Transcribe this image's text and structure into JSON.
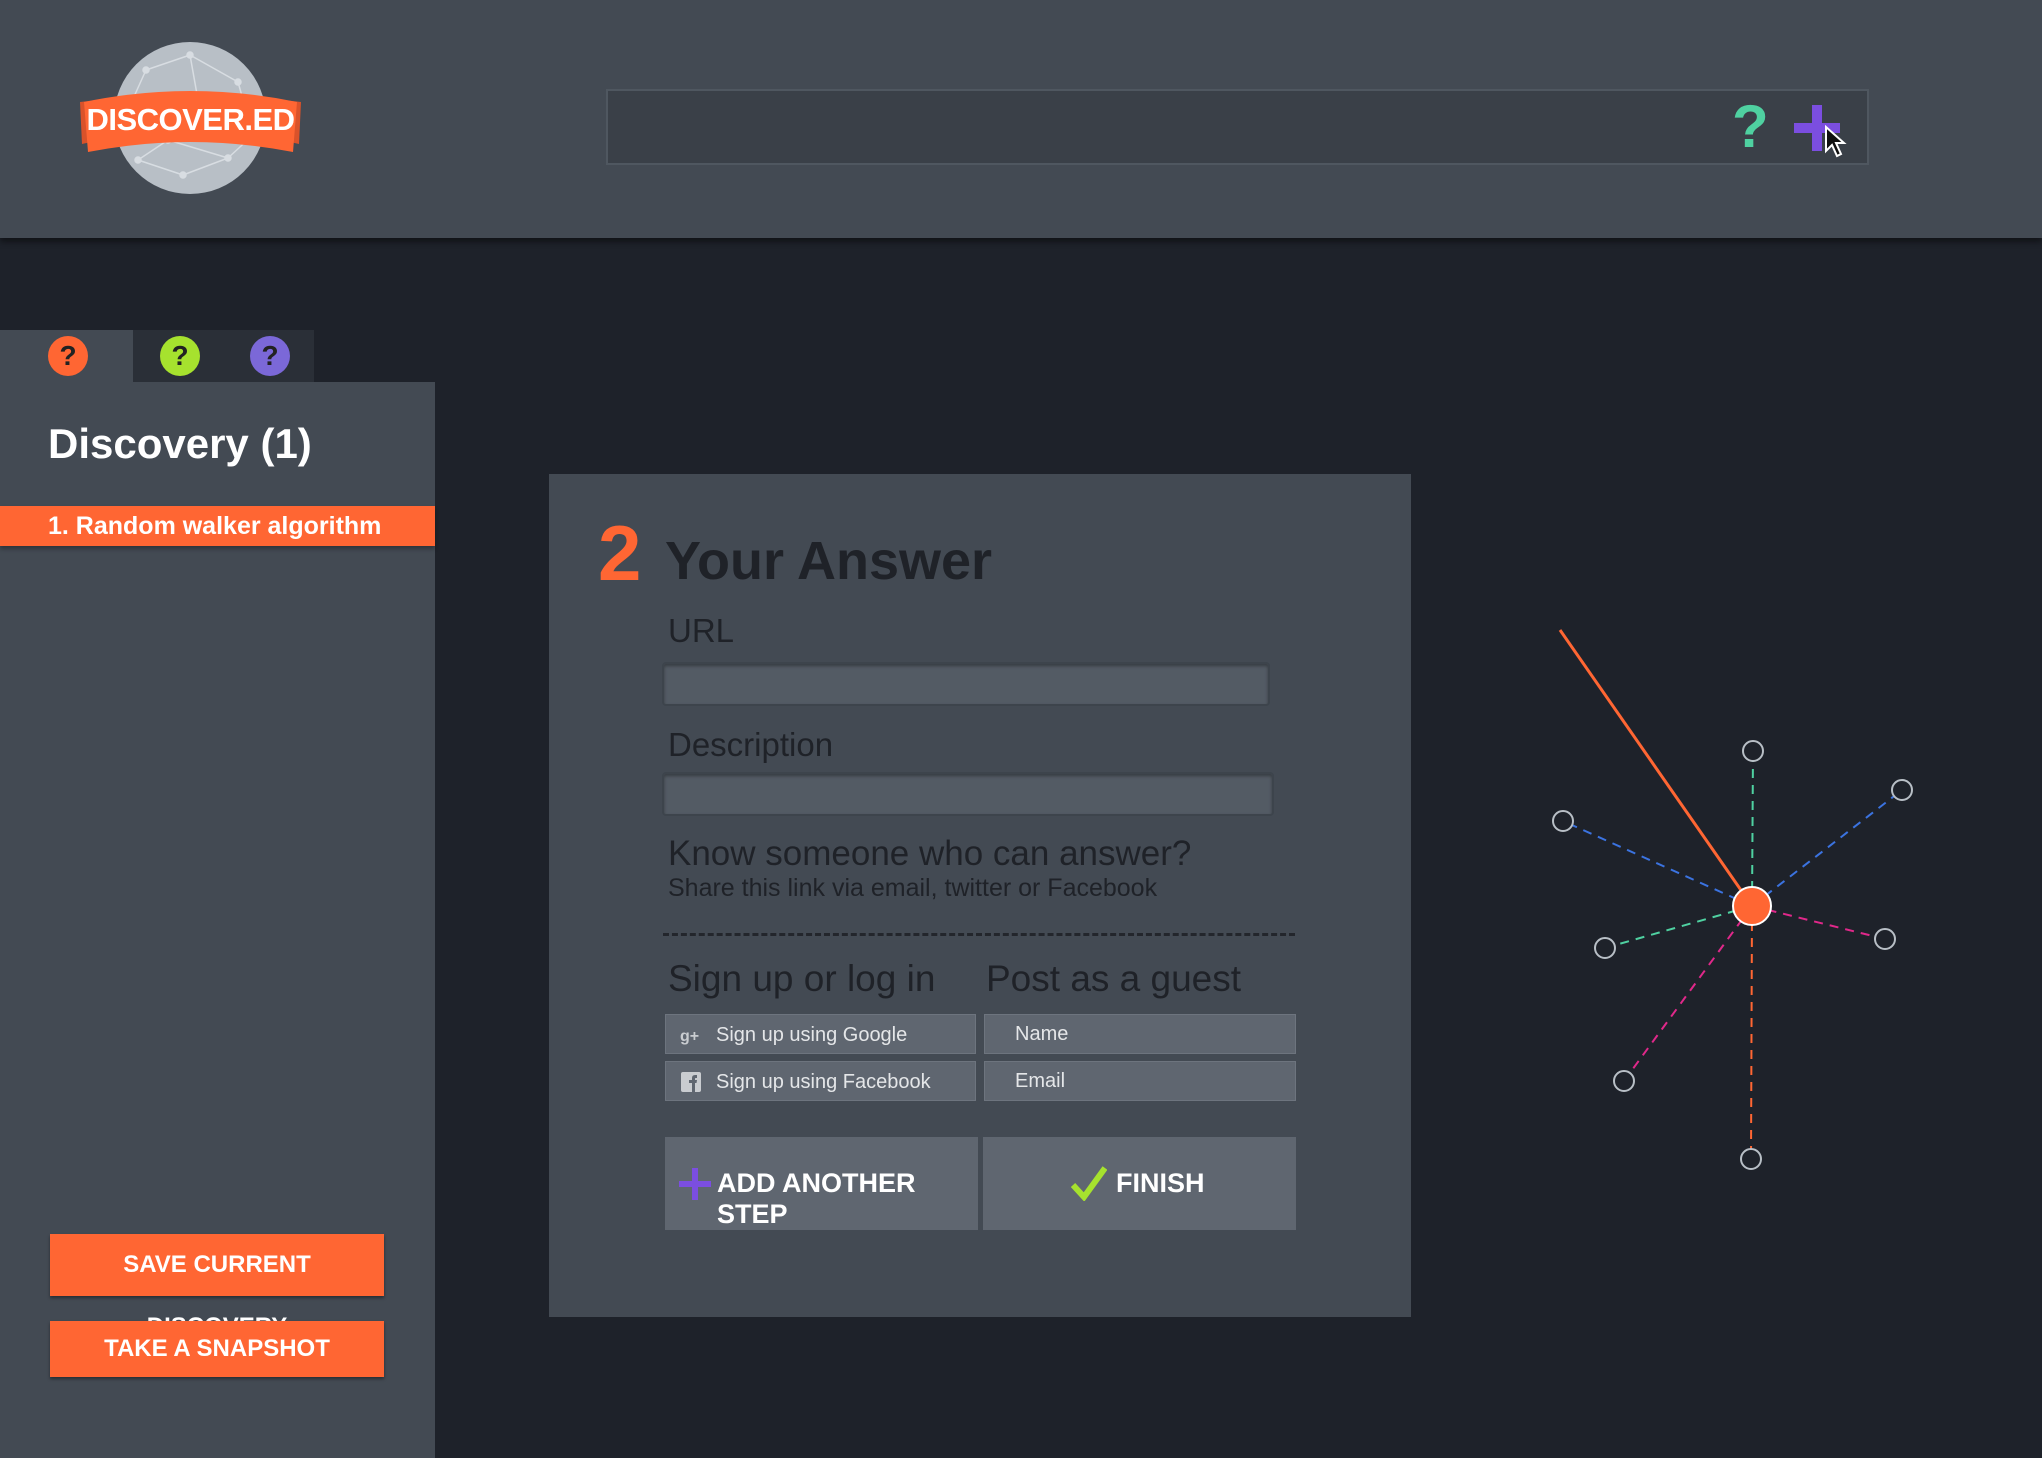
{
  "header": {
    "logo_text": "DISCOVER.ED",
    "search_placeholder": "",
    "help_icon": "question-mark-icon",
    "add_icon": "plus-icon",
    "colors": {
      "header_bg": "#434a53",
      "help": "#4fd1a1",
      "add": "#7b4ee0"
    }
  },
  "tabs": [
    {
      "icon": "question-mark-icon",
      "color": "#ff6633"
    },
    {
      "icon": "question-mark-icon",
      "color": "#a6e22e"
    },
    {
      "icon": "question-mark-icon",
      "color": "#7b68d8"
    }
  ],
  "sidebar": {
    "title": "Discovery (1)",
    "items": [
      {
        "label": "1. Random walker algorithm"
      }
    ],
    "save_label": "SAVE CURRENT DISCOVERY",
    "snapshot_label": "TAKE A SNAPSHOT"
  },
  "card": {
    "step_number": "2",
    "title": "Your Answer",
    "url_label": "URL",
    "url_value": "",
    "description_label": "Description",
    "description_value": "",
    "know_heading": "Know someone who can answer?",
    "share_text": "Share this link via email, twitter or Facebook",
    "signup_heading": "Sign up or log in",
    "guest_heading": "Post as a guest",
    "google_label": "Sign up using Google",
    "facebook_label": "Sign up using Facebook",
    "name_placeholder": "Name",
    "email_placeholder": "Email",
    "add_step_label": "ADD ANOTHER STEP",
    "finish_label": "FINISH"
  },
  "accent": "#ff6633"
}
